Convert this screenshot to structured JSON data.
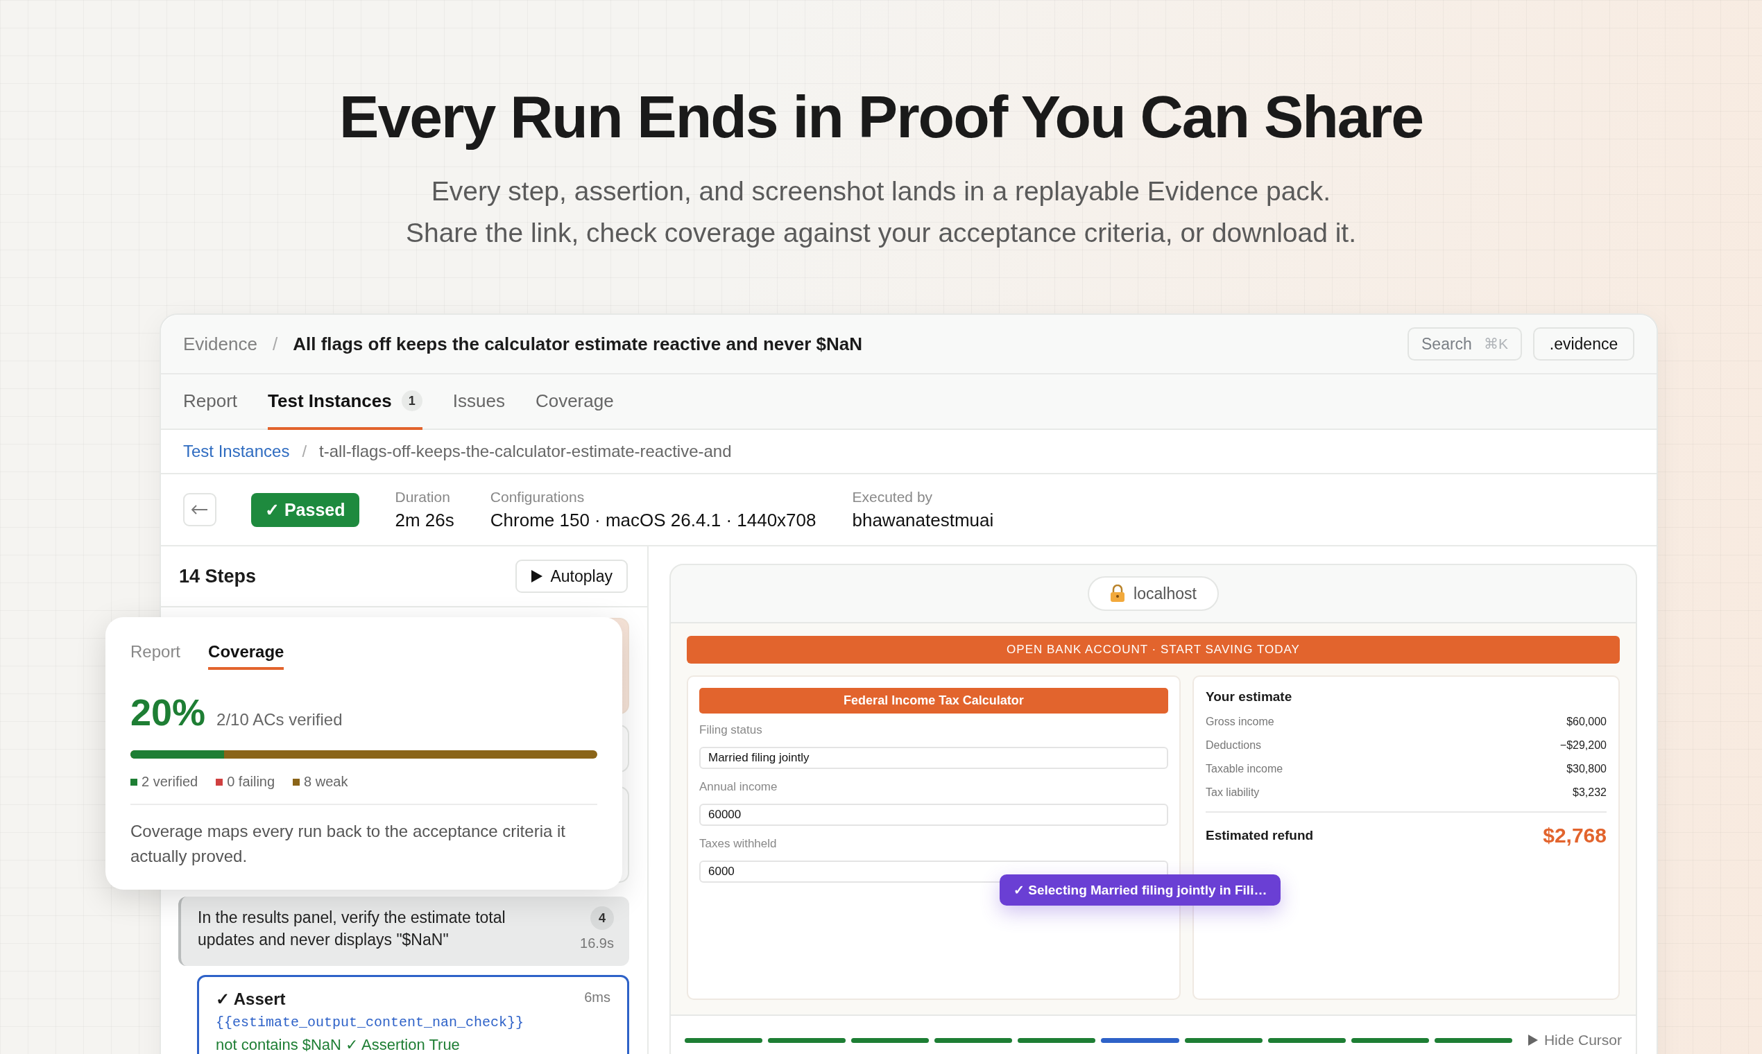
{
  "hero": {
    "title": "Every Run Ends in Proof You Can Share",
    "subtitle_lines": [
      "Every step, assertion, and screenshot lands in a replayable Evidence pack.",
      "Share the link, check coverage against your acceptance criteria, or download it."
    ]
  },
  "app": {
    "breadcrumb": {
      "root": "Evidence",
      "separator": "/",
      "current": "All flags off keeps the calculator estimate reactive and never $NaN"
    },
    "search": {
      "placeholder": "Search",
      "shortcut": "⌘K"
    },
    "evidence_button": ".evidence",
    "tabs": [
      {
        "label": "Report",
        "selected": false
      },
      {
        "label": "Test Instances",
        "selected": true,
        "badge": "1"
      },
      {
        "label": "Issues",
        "selected": false
      },
      {
        "label": "Coverage",
        "selected": false
      }
    ],
    "sub_breadcrumb": {
      "link": "Test Instances",
      "separator": "/",
      "current": "t-all-flags-off-keeps-the-calculator-estimate-reactive-and"
    },
    "run": {
      "status": {
        "label": "✓ Passed",
        "kind": "passed"
      },
      "meta": [
        {
          "label": "Duration",
          "value": "2m 26s"
        },
        {
          "label": "Configurations",
          "value": "Chrome 150 · macOS 26.4.1 · 1440x708"
        },
        {
          "label": "Executed by",
          "value": "bhawanatestmuai"
        }
      ]
    },
    "steps": {
      "title": "14 Steps",
      "autoplay": "Autoplay",
      "step": {
        "text": "In the results panel, verify the estimate total updates and never displays \"$NaN\"",
        "badge": "4",
        "time": "16.9s"
      },
      "assert": {
        "title": "✓ Assert",
        "time": "6ms",
        "code": "{{estimate_output_content_nan_check}}",
        "result": "not contains $NaN ✓ Assertion True"
      }
    },
    "coverage_popup": {
      "tabs": [
        {
          "label": "Report",
          "selected": false
        },
        {
          "label": "Coverage",
          "selected": true
        }
      ],
      "percent": "20%",
      "summary": "2/10 ACs verified",
      "level": 0.2,
      "legend": [
        {
          "label": "2 verified",
          "color": "#1e7e34"
        },
        {
          "label": "0 failing",
          "color": "#d04040"
        },
        {
          "label": "8 weak",
          "color": "#8a6418"
        }
      ],
      "description": "Coverage maps every run back to the acceptance criteria it actually proved."
    },
    "browser": {
      "address": "localhost",
      "banner": "OPEN BANK ACCOUNT · START SAVING TODAY",
      "form": {
        "title": "Federal Income Tax Calculator",
        "fields": [
          {
            "label": "Filing status",
            "value": "Married filing jointly"
          },
          {
            "label": "Annual income",
            "value": "60000"
          },
          {
            "label": "Taxes withheld",
            "value": "6000"
          }
        ]
      },
      "estimate": {
        "title": "Your estimate",
        "rows": [
          {
            "label": "Gross income",
            "value": "$60,000"
          },
          {
            "label": "Deductions",
            "value": "−$29,200"
          },
          {
            "label": "Taxable income",
            "value": "$30,800"
          },
          {
            "label": "Tax liability",
            "value": "$3,232"
          }
        ],
        "total": {
          "label": "Estimated refund",
          "value": "$2,768"
        }
      },
      "tooltip": "✓ Selecting Married filing jointly in Fili…",
      "timeline": [
        {
          "current": false
        },
        {
          "current": false
        },
        {
          "current": false
        },
        {
          "current": false
        },
        {
          "current": false
        },
        {
          "current": true
        },
        {
          "current": false
        },
        {
          "current": false
        },
        {
          "current": false
        },
        {
          "current": false
        }
      ],
      "hide_cursor": "Hide Cursor"
    }
  }
}
